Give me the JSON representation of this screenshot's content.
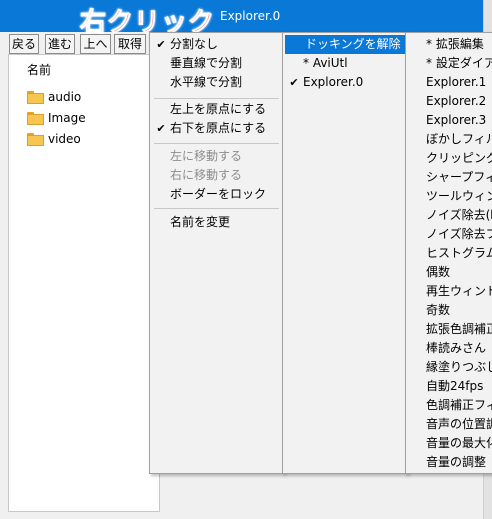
{
  "window": {
    "title": "Explorer.0"
  },
  "annotation": {
    "text": "右クリック"
  },
  "toolbar": {
    "buttons": [
      "戻る",
      "進む",
      "上へ",
      "取得"
    ]
  },
  "file_list": {
    "column_header": "名前",
    "items": [
      "audio",
      "Image",
      "video"
    ]
  },
  "menu1": {
    "group1": [
      {
        "label": "分割なし",
        "checked": true,
        "disabled": false
      },
      {
        "label": "垂直線で分割",
        "checked": false,
        "disabled": false
      },
      {
        "label": "水平線で分割",
        "checked": false,
        "disabled": false
      }
    ],
    "group2": [
      {
        "label": "左上を原点にする",
        "checked": false,
        "disabled": false
      },
      {
        "label": "右下を原点にする",
        "checked": true,
        "disabled": false
      }
    ],
    "group3": [
      {
        "label": "左に移動する",
        "checked": false,
        "disabled": true
      },
      {
        "label": "右に移動する",
        "checked": false,
        "disabled": true
      },
      {
        "label": "ボーダーをロック",
        "checked": false,
        "disabled": false
      }
    ],
    "group4": [
      {
        "label": "名前を変更",
        "checked": false,
        "disabled": false
      }
    ]
  },
  "menu2": {
    "items": [
      {
        "label": "ドッキングを解除",
        "checked": false,
        "highlighted": true
      },
      {
        "label": "* AviUtl",
        "checked": false,
        "highlighted": false
      },
      {
        "label": "Explorer.0",
        "checked": true,
        "highlighted": false
      }
    ]
  },
  "menu3": {
    "items": [
      "* 拡張編集",
      "* 設定ダイアログ",
      "Explorer.1",
      "Explorer.2",
      "Explorer.3",
      "ぼかしフィルタ",
      "クリッピング＆リサイズ",
      "シャープフィルタ",
      "ツールウィンドウ",
      "ノイズ除去(時間軸)",
      "ノイズ除去フィルタ",
      "ヒストグラム",
      "偶数",
      "再生ウィンドウ",
      "奇数",
      "拡張色調補正",
      "棒読みさん",
      "縁塗りつぶし",
      "自動24fps",
      "色調補正フィルタ",
      "音声の位置調整",
      "音量の最大化",
      "音量の調整"
    ]
  },
  "colors": {
    "accent": "#0a78d7",
    "annotation": "#e8182a",
    "disabled_text": "#8d8d8d"
  }
}
